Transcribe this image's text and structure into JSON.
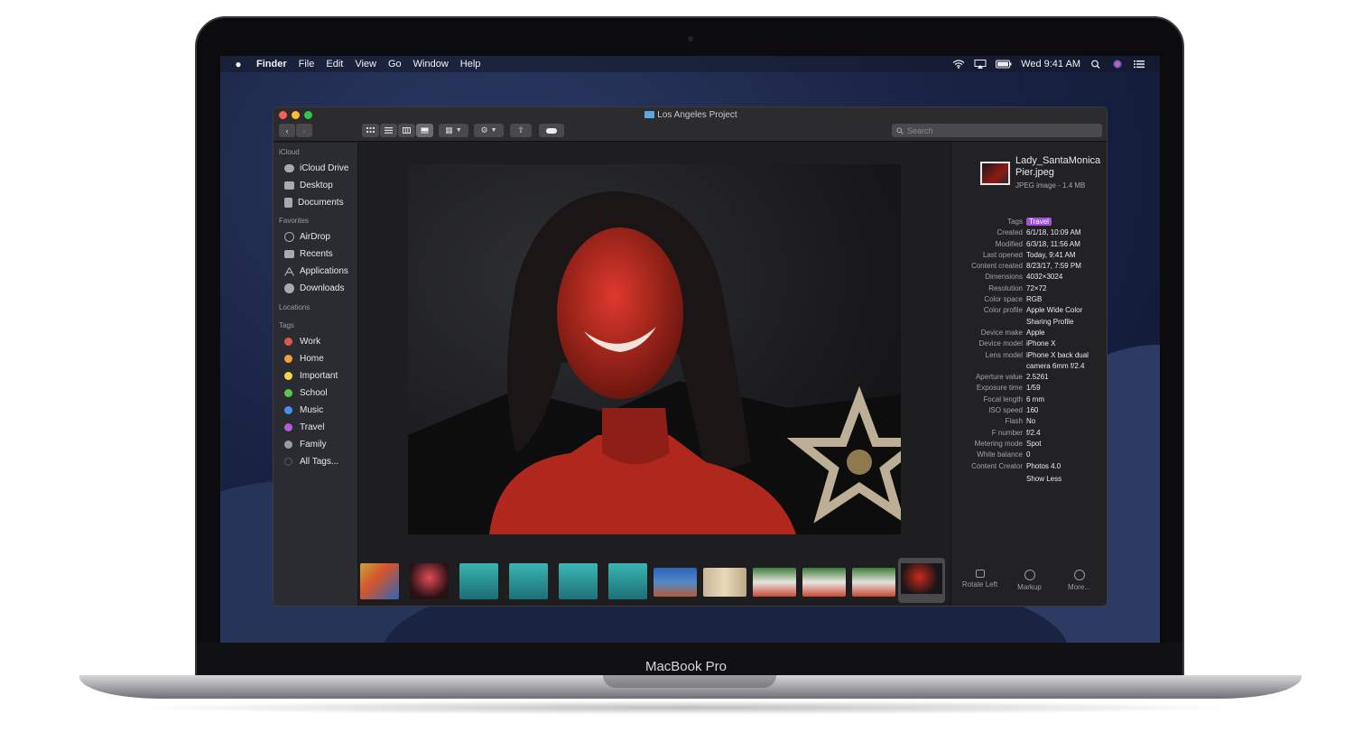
{
  "menubar": {
    "apple_icon": "apple-logo-icon",
    "app_name": "Finder",
    "menus": [
      "File",
      "Edit",
      "View",
      "Go",
      "Window",
      "Help"
    ],
    "clock": "Wed 9:41 AM",
    "status_icons": [
      "wifi-icon",
      "airplay-icon",
      "battery-icon",
      "search-icon",
      "siri-icon",
      "notification-center-icon"
    ]
  },
  "window": {
    "title": "Los Angeles Project",
    "search_placeholder": "Search"
  },
  "sidebar": {
    "sections": {
      "icloud": "iCloud",
      "favorites": "Favorites",
      "locations": "Locations",
      "tags": "Tags"
    },
    "icloud_items": [
      "iCloud Drive",
      "Desktop",
      "Documents"
    ],
    "favorite_items": [
      "AirDrop",
      "Recents",
      "Applications",
      "Downloads"
    ],
    "tag_items": [
      {
        "label": "Work",
        "color": "#e2564d"
      },
      {
        "label": "Home",
        "color": "#f1a23b"
      },
      {
        "label": "Important",
        "color": "#f3d64a"
      },
      {
        "label": "School",
        "color": "#5dc44f"
      },
      {
        "label": "Music",
        "color": "#4a8ef0"
      },
      {
        "label": "Travel",
        "color": "#b35ce0"
      },
      {
        "label": "Family",
        "color": "#9a9aa0"
      },
      {
        "label": "All Tags...",
        "color": "#5a5a5e"
      }
    ]
  },
  "inspector": {
    "file_name": "Lady_SantaMonicaPier.jpeg",
    "file_type": "JPEG image - 1.4 MB",
    "tags_label": "Tags",
    "tag_value": "Travel",
    "metadata": [
      {
        "key": "Created",
        "value": "6/1/18, 10:09 AM"
      },
      {
        "key": "Modified",
        "value": "6/3/18, 11:56 AM"
      },
      {
        "key": "Last opened",
        "value": "Today, 9:41 AM"
      },
      {
        "key": "Content created",
        "value": "8/23/17, 7:59 PM"
      },
      {
        "key": "Dimensions",
        "value": "4032×3024"
      },
      {
        "key": "Resolution",
        "value": "72×72"
      },
      {
        "key": "Color space",
        "value": "RGB"
      },
      {
        "key": "Color profile",
        "value": "Apple Wide Color Sharing Profile"
      },
      {
        "key": "Device make",
        "value": "Apple"
      },
      {
        "key": "Device model",
        "value": "iPhone X"
      },
      {
        "key": "Lens model",
        "value": "iPhone X back dual camera 6mm f/2.4"
      },
      {
        "key": "Aperture value",
        "value": "2.5261"
      },
      {
        "key": "Exposure time",
        "value": "1/59"
      },
      {
        "key": "Focal length",
        "value": "6 mm"
      },
      {
        "key": "ISO speed",
        "value": "160"
      },
      {
        "key": "Flash",
        "value": "No"
      },
      {
        "key": "F number",
        "value": "f/2.4"
      },
      {
        "key": "Metering mode",
        "value": "Spot"
      },
      {
        "key": "White balance",
        "value": "0"
      },
      {
        "key": "Content Creator",
        "value": "Photos 4.0"
      }
    ],
    "show_less": "Show Less",
    "actions": [
      "Rotate Left",
      "Markup",
      "More..."
    ]
  },
  "device_label": "MacBook Pro"
}
